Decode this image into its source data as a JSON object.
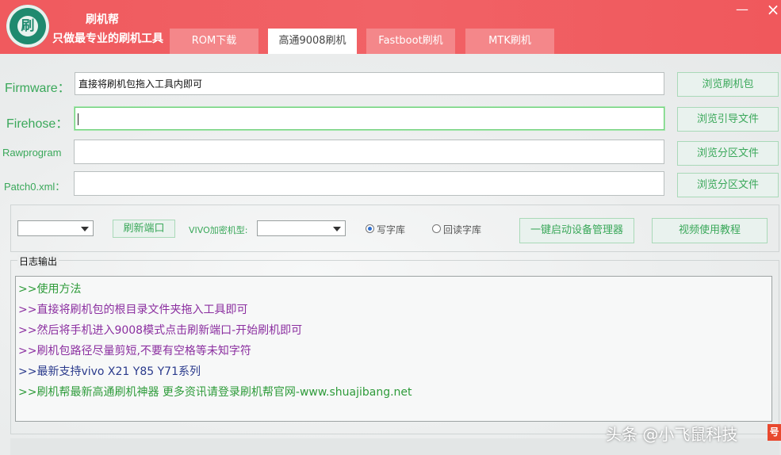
{
  "app": {
    "name": "刷机帮",
    "slogan": "只做最专业的刷机工具",
    "minimize_glyph": "—",
    "close_glyph": "×"
  },
  "tabs": [
    {
      "label": "ROM下载",
      "active": false
    },
    {
      "label": "高通9008刷机",
      "active": true
    },
    {
      "label": "Fastboot刷机",
      "active": false
    },
    {
      "label": "MTK刷机",
      "active": false
    }
  ],
  "files": {
    "firmware": {
      "label": "Firmware：",
      "value": "直接将刷机包拖入工具内即可",
      "button": "浏览刷机包"
    },
    "firehose": {
      "label": "Firehose：",
      "value": "",
      "button": "浏览引导文件"
    },
    "rawprogram": {
      "label": "Rawprogram",
      "value": "",
      "button": "浏览分区文件"
    },
    "patch0": {
      "label": "Patch0.xml：",
      "value": "",
      "button": "浏览分区文件"
    }
  },
  "toolbar": {
    "port_select_value": "",
    "refresh_port_button": "刷新端口",
    "vivo_model_label": "VIVO加密机型:",
    "vivo_model_value": "",
    "write_radio_label": "写字库",
    "write_radio_selected": true,
    "read_radio_label": "回读字库",
    "read_radio_selected": false,
    "device_manager_button": "一键启动设备管理器",
    "video_tutorial_button": "视频使用教程"
  },
  "log": {
    "title": "日志输出",
    "lines": [
      {
        "text": ">>使用方法",
        "color": "#2e9b3a"
      },
      {
        "text": ">>直接将刷机包的根目录文件夹拖入工具即可",
        "color": "#8b2fa0"
      },
      {
        "text": ">>然后将手机进入9008模式点击刷新端口-开始刷机即可",
        "color": "#8b2fa0"
      },
      {
        "text": ">>刷机包路径尽量剪短,不要有空格等未知字符",
        "color": "#8b2fa0"
      },
      {
        "text": ">>最新支持vivo X21 Y85 Y71系列",
        "color": "#2a3a8c"
      },
      {
        "text": ">>刷机帮最新高通刷机神器 更多资讯请登录刷机帮官网-www.shuajibang.net",
        "color": "#2e9b3a"
      }
    ]
  },
  "watermark": {
    "text": "头条 @小飞鼠科技",
    "badge": "号"
  },
  "colors": {
    "titlebar": "#f05a5e",
    "accent_green": "#3aa85a",
    "radio_selected": "#2f6fd0"
  }
}
